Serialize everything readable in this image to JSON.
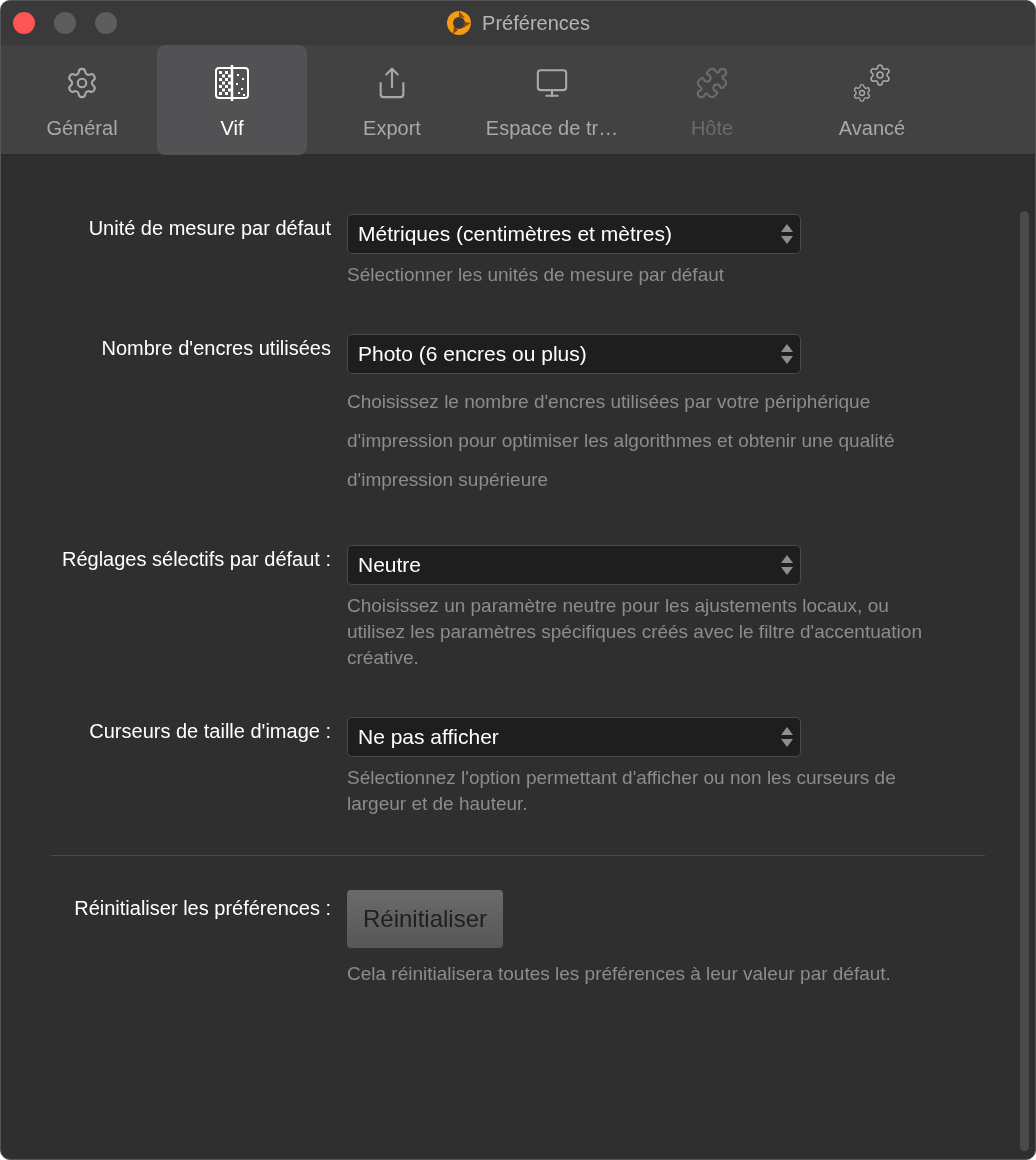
{
  "window": {
    "title": "Préférences"
  },
  "tabs": [
    {
      "kind": "gear",
      "label": "Général",
      "selected": false,
      "disabled": false
    },
    {
      "kind": "vivid",
      "label": "Vif",
      "selected": true,
      "disabled": false
    },
    {
      "kind": "export",
      "label": "Export",
      "selected": false,
      "disabled": false
    },
    {
      "kind": "monitor",
      "label": "Espace de tr…",
      "selected": false,
      "disabled": false
    },
    {
      "kind": "puzzle",
      "label": "Hôte",
      "selected": false,
      "disabled": true
    },
    {
      "kind": "gears",
      "label": "Avancé",
      "selected": false,
      "disabled": false
    }
  ],
  "settings": [
    {
      "label": "Unité de mesure par défaut",
      "value": "Métriques (centimètres et mètres)",
      "description": "Sélectionner les unités de mesure par défaut"
    },
    {
      "label": "Nombre d'encres utilisées",
      "value": "Photo (6 encres ou plus)",
      "description": "Choisissez le nombre d'encres utilisées par votre périphérique d'impression pour optimiser les algorithmes et obtenir une qualité d'impression supérieure"
    },
    {
      "label": "Réglages sélectifs par défaut :",
      "value": "Neutre",
      "description": "Choisissez un paramètre neutre pour les ajustements locaux, ou utilisez les paramètres spécifiques créés avec le filtre d'accentuation créative."
    },
    {
      "label": "Curseurs de taille d'image :",
      "value": "Ne pas afficher",
      "description": "Sélectionnez l'option permettant d'afficher ou non les curseurs de largeur et de hauteur."
    }
  ],
  "reset": {
    "label": "Réinitialiser les préférences :",
    "button": "Réinitialiser",
    "description": "Cela réinitialisera toutes les préférences à leur valeur par défaut."
  }
}
